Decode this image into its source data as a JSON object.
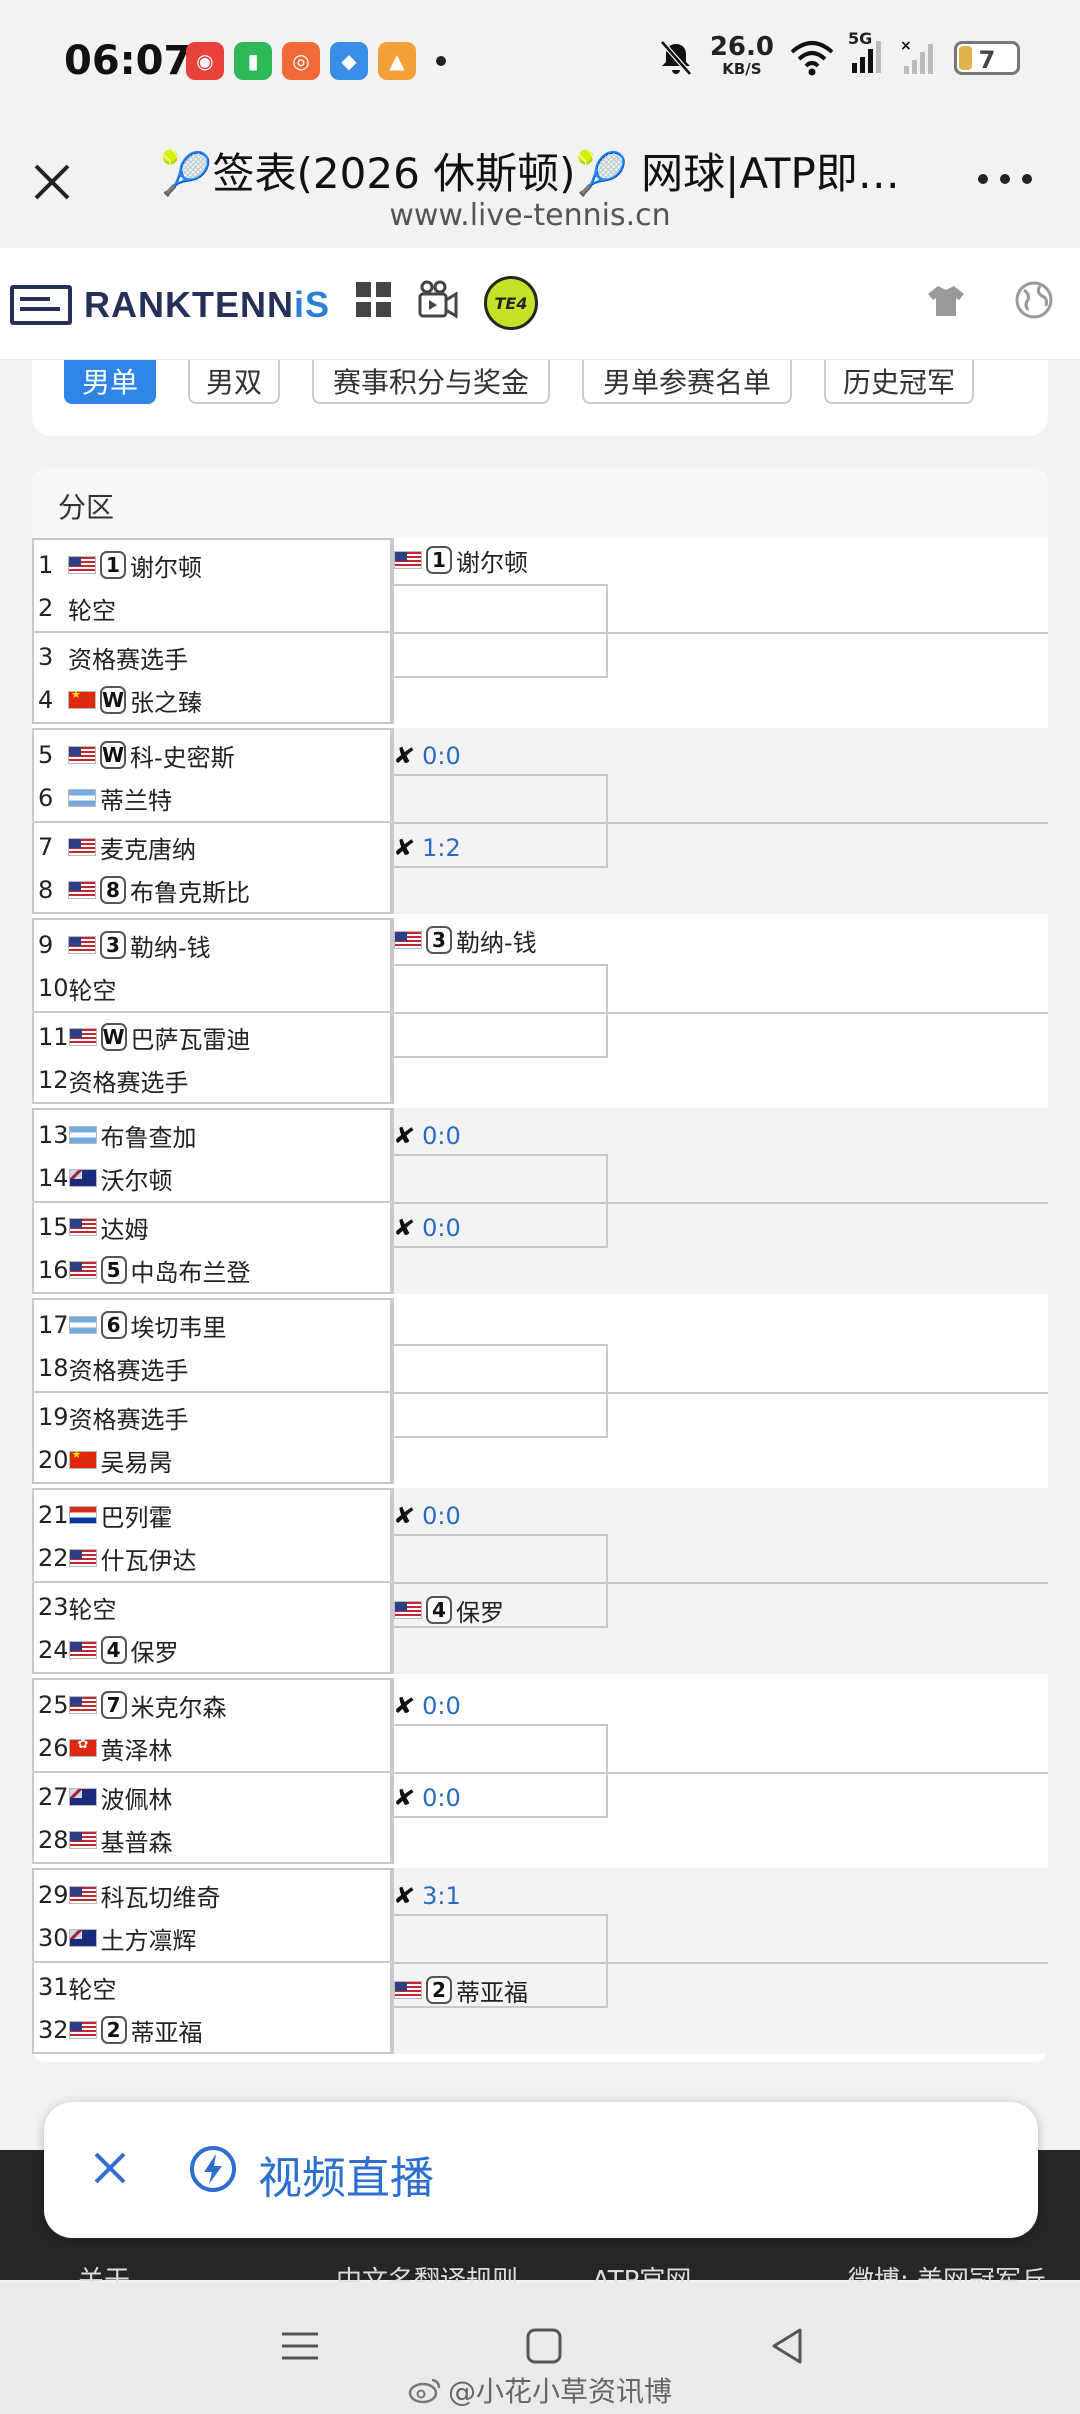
{
  "status_bar": {
    "time": "06:07",
    "net_speed": "26.0",
    "net_unit": "KB/S",
    "network_type": "5G",
    "battery": "7"
  },
  "browser": {
    "title": "🎾签表(2026 休斯顿)🎾 网球|ATP即…",
    "url": "www.live-tennis.cn"
  },
  "site": {
    "logo_prefix": "RANKTENN",
    "logo_i": "i",
    "logo_suffix": "S",
    "te_badge": "TE4"
  },
  "tabs": [
    {
      "label": "男单",
      "active": true
    },
    {
      "label": "男双",
      "active": false
    },
    {
      "label": "赛事积分与奖金",
      "active": false
    },
    {
      "label": "男单参赛名单",
      "active": false
    },
    {
      "label": "历史冠军",
      "active": false
    }
  ],
  "draw": {
    "header": "分区",
    "sections": [
      {
        "players": [
          {
            "pos": "1",
            "flag": "us",
            "seed": "1",
            "name": "谢尔顿"
          },
          {
            "pos": "2",
            "flag": "",
            "seed": "",
            "name": "轮空"
          },
          {
            "pos": "3",
            "flag": "",
            "seed": "",
            "name": "资格赛选手"
          },
          {
            "pos": "4",
            "flag": "cn",
            "seed": "W",
            "name": "张之臻"
          }
        ],
        "r2": [
          {
            "type": "player",
            "flag": "us",
            "seed": "1",
            "name": "谢尔顿",
            "score": ""
          },
          {
            "type": "none",
            "flag": "",
            "seed": "",
            "name": "",
            "score": ""
          }
        ]
      },
      {
        "players": [
          {
            "pos": "5",
            "flag": "us",
            "seed": "W",
            "name": "科-史密斯"
          },
          {
            "pos": "6",
            "flag": "ar",
            "seed": "",
            "name": "蒂兰特"
          },
          {
            "pos": "7",
            "flag": "us",
            "seed": "",
            "name": "麦克唐纳"
          },
          {
            "pos": "8",
            "flag": "us",
            "seed": "8",
            "name": "布鲁克斯比"
          }
        ],
        "r2": [
          {
            "type": "score",
            "flag": "",
            "seed": "",
            "name": "",
            "score": "0:0"
          },
          {
            "type": "score",
            "flag": "",
            "seed": "",
            "name": "",
            "score": "1:2"
          }
        ]
      },
      {
        "players": [
          {
            "pos": "9",
            "flag": "us",
            "seed": "3",
            "name": "勒纳-钱"
          },
          {
            "pos": "10",
            "flag": "",
            "seed": "",
            "name": "轮空"
          },
          {
            "pos": "11",
            "flag": "us",
            "seed": "W",
            "name": "巴萨瓦雷迪"
          },
          {
            "pos": "12",
            "flag": "",
            "seed": "",
            "name": "资格赛选手"
          }
        ],
        "r2": [
          {
            "type": "player",
            "flag": "us",
            "seed": "3",
            "name": "勒纳-钱",
            "score": ""
          },
          {
            "type": "none",
            "flag": "",
            "seed": "",
            "name": "",
            "score": ""
          }
        ]
      },
      {
        "players": [
          {
            "pos": "13",
            "flag": "ar",
            "seed": "",
            "name": "布鲁查加"
          },
          {
            "pos": "14",
            "flag": "au",
            "seed": "",
            "name": "沃尔顿"
          },
          {
            "pos": "15",
            "flag": "us",
            "seed": "",
            "name": "达姆"
          },
          {
            "pos": "16",
            "flag": "us",
            "seed": "5",
            "name": "中岛布兰登"
          }
        ],
        "r2": [
          {
            "type": "score",
            "flag": "",
            "seed": "",
            "name": "",
            "score": "0:0"
          },
          {
            "type": "score",
            "flag": "",
            "seed": "",
            "name": "",
            "score": "0:0"
          }
        ]
      },
      {
        "players": [
          {
            "pos": "17",
            "flag": "ar",
            "seed": "6",
            "name": "埃切韦里"
          },
          {
            "pos": "18",
            "flag": "",
            "seed": "",
            "name": "资格赛选手"
          },
          {
            "pos": "19",
            "flag": "",
            "seed": "",
            "name": "资格赛选手"
          },
          {
            "pos": "20",
            "flag": "cn",
            "seed": "",
            "name": "吴易昺"
          }
        ],
        "r2": [
          {
            "type": "none",
            "flag": "",
            "seed": "",
            "name": "",
            "score": ""
          },
          {
            "type": "none",
            "flag": "",
            "seed": "",
            "name": "",
            "score": ""
          }
        ]
      },
      {
        "players": [
          {
            "pos": "21",
            "flag": "py",
            "seed": "",
            "name": "巴列霍"
          },
          {
            "pos": "22",
            "flag": "us",
            "seed": "",
            "name": "什瓦伊达"
          },
          {
            "pos": "23",
            "flag": "",
            "seed": "",
            "name": "轮空"
          },
          {
            "pos": "24",
            "flag": "us",
            "seed": "4",
            "name": "保罗"
          }
        ],
        "r2": [
          {
            "type": "score",
            "flag": "",
            "seed": "",
            "name": "",
            "score": "0:0"
          },
          {
            "type": "player",
            "flag": "us",
            "seed": "4",
            "name": "保罗",
            "score": ""
          }
        ]
      },
      {
        "players": [
          {
            "pos": "25",
            "flag": "us",
            "seed": "7",
            "name": "米克尔森"
          },
          {
            "pos": "26",
            "flag": "hk",
            "seed": "",
            "name": "黄泽林"
          },
          {
            "pos": "27",
            "flag": "au",
            "seed": "",
            "name": "波佩林"
          },
          {
            "pos": "28",
            "flag": "us",
            "seed": "",
            "name": "基普森"
          }
        ],
        "r2": [
          {
            "type": "score",
            "flag": "",
            "seed": "",
            "name": "",
            "score": "0:0"
          },
          {
            "type": "score",
            "flag": "",
            "seed": "",
            "name": "",
            "score": "0:0"
          }
        ]
      },
      {
        "players": [
          {
            "pos": "29",
            "flag": "us",
            "seed": "",
            "name": "科瓦切维奇"
          },
          {
            "pos": "30",
            "flag": "au",
            "seed": "",
            "name": "土方凛辉"
          },
          {
            "pos": "31",
            "flag": "",
            "seed": "",
            "name": "轮空"
          },
          {
            "pos": "32",
            "flag": "us",
            "seed": "2",
            "name": "蒂亚福"
          }
        ],
        "r2": [
          {
            "type": "score",
            "flag": "",
            "seed": "",
            "name": "",
            "score": "3:1"
          },
          {
            "type": "player",
            "flag": "us",
            "seed": "2",
            "name": "蒂亚福",
            "score": ""
          }
        ]
      }
    ]
  },
  "overlay": {
    "video_label": "视频直播"
  },
  "footer": {
    "links": [
      "关于",
      "中文名翻译规则",
      "ATP官网",
      "微博: 美网冠军丘"
    ]
  },
  "watermark": "@小花小草资讯博",
  "icons": {
    "close": "close-icon",
    "more": "more-dots-icon",
    "grid": "grid-icon",
    "video": "video-camera-icon",
    "shirt": "shirt-icon",
    "globe": "globe-icon",
    "lightning": "lightning-icon",
    "tbd": "pending-match-icon"
  },
  "colors": {
    "accent": "#2f86e6",
    "score_link": "#2a6bbf",
    "logo_navy": "#23305a"
  }
}
